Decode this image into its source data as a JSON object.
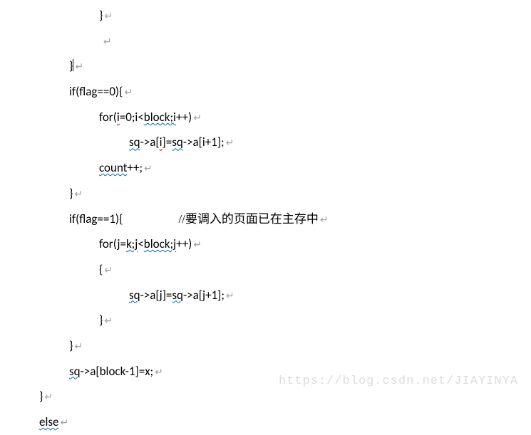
{
  "code": {
    "l1": "}",
    "l2": " ",
    "l3": "}",
    "l4a": "if(flag==0){",
    "l5a": "for(",
    "l5b": "i",
    "l5c": "=0;i<",
    "l5d": "block;i",
    "l5e": "++)",
    "l6a": "sq",
    "l6b": "->a[",
    "l6c": "i",
    "l6d": "]=",
    "l6e": "sq",
    "l6f": "->a[i+1];",
    "l7a": "count",
    "l7b": "++;",
    "l8": "}",
    "l9a": "if(flag==1){",
    "l9b": "//要调入的页面已在主存中",
    "l10a": "for(",
    "l10b": "j=",
    "l10c": "k;j",
    "l10d": "<",
    "l10e": "block;j",
    "l10f": "++)",
    "l11": "{",
    "l12a": "sq",
    "l12b": "->a[j]=",
    "l12c": "sq",
    "l12d": "->a[j+1];",
    "l13": "}",
    "l14": "}",
    "l15a": "sq",
    "l15b": "->a[block-1]=x;",
    "l16": "}",
    "l17": "else"
  },
  "watermark": "https://blog.csdn.net/JIAYINYA",
  "return_mark": "↵"
}
